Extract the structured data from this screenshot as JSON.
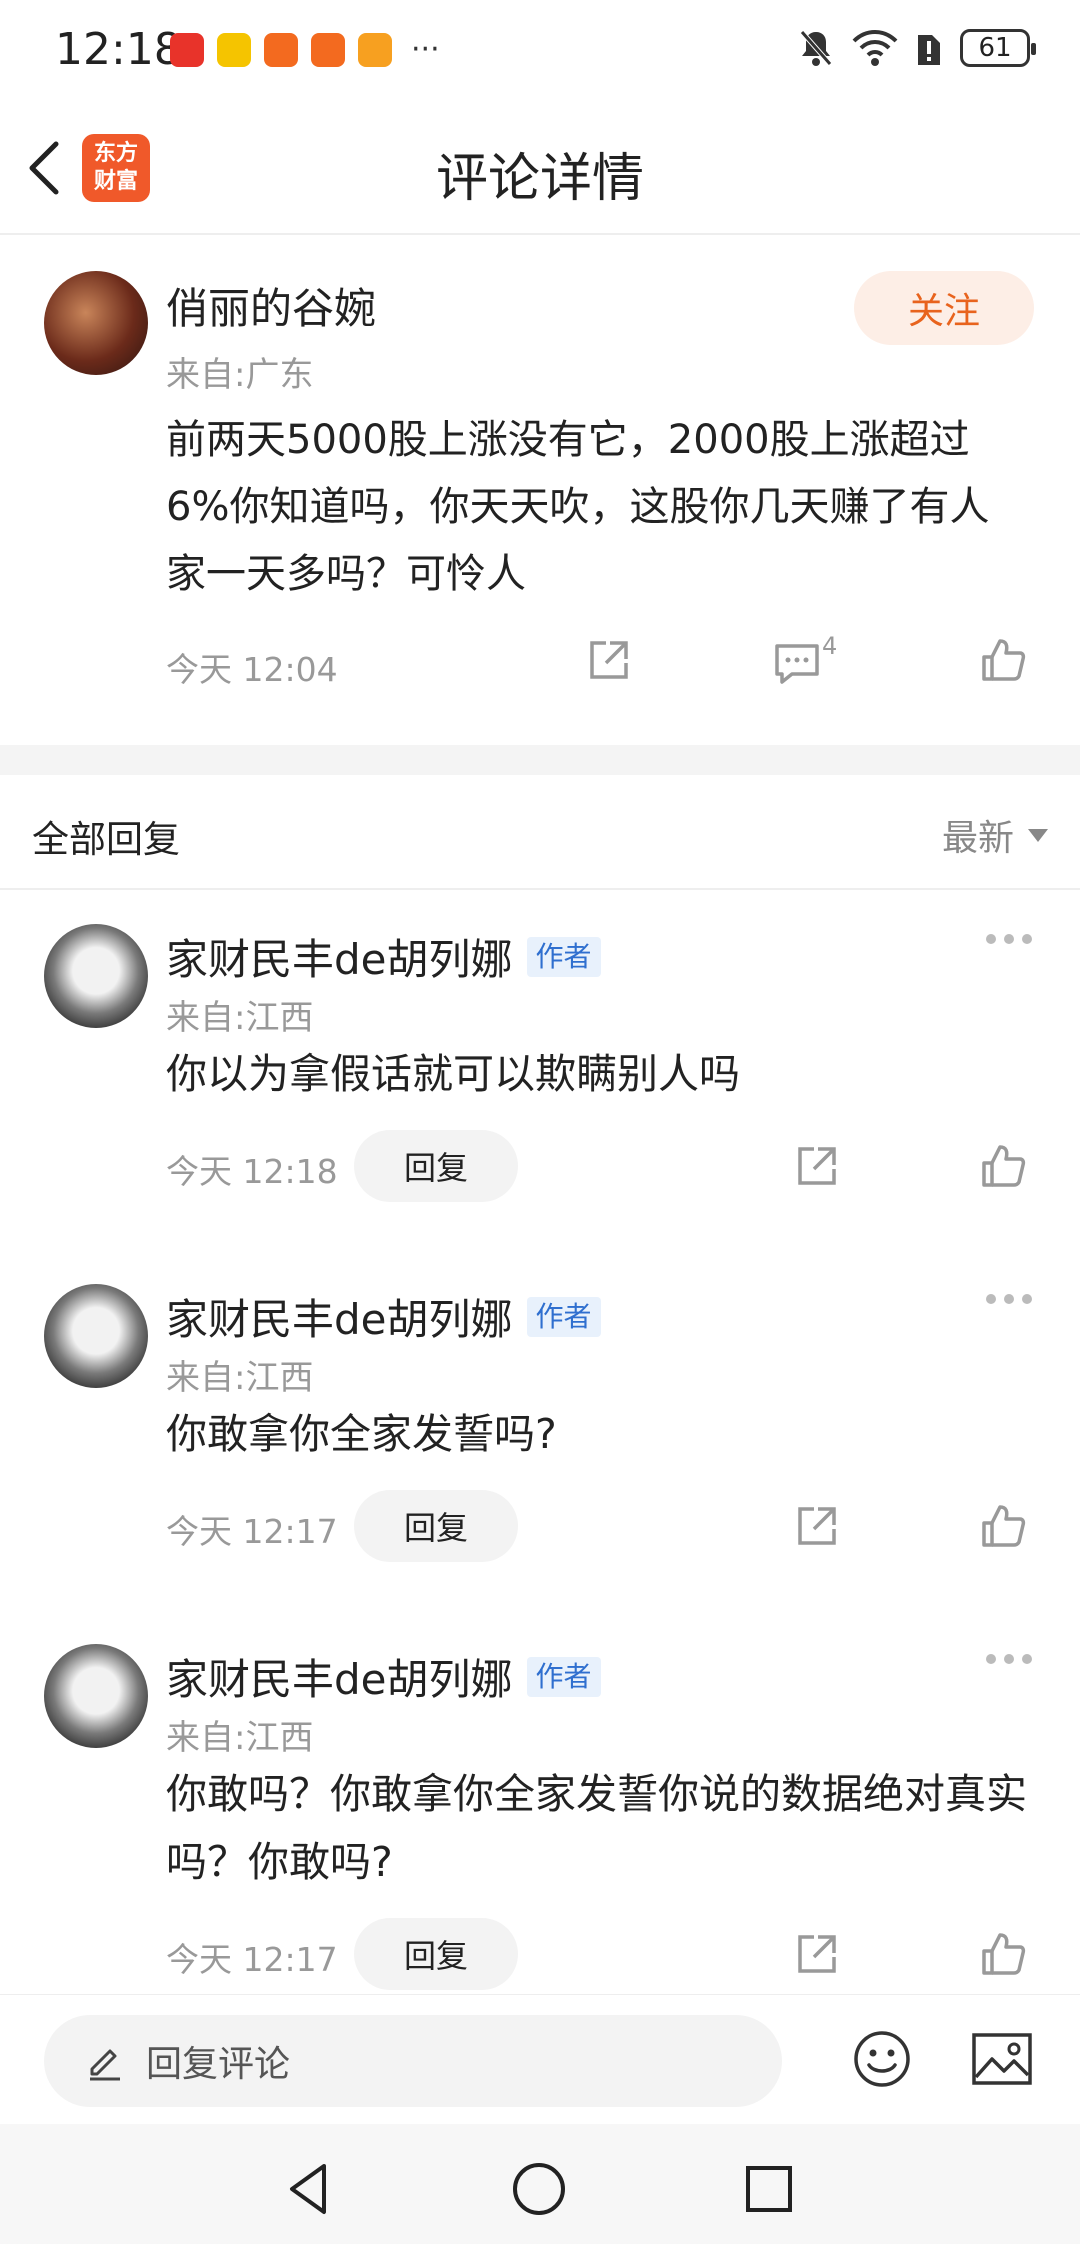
{
  "status_bar": {
    "time": "12:18",
    "more": "···",
    "battery": "61",
    "app_icons": [
      {
        "name": "app-icon-1",
        "color": "#e8332a"
      },
      {
        "name": "weibo-icon",
        "color": "#f5c400"
      },
      {
        "name": "app-icon-3",
        "color": "#f36a1f"
      },
      {
        "name": "app-icon-4",
        "color": "#f36a1f"
      },
      {
        "name": "app-icon-5",
        "color": "#f7a020"
      }
    ]
  },
  "nav": {
    "logo_line1": "东方",
    "logo_line2": "财富",
    "title": "评论详情"
  },
  "main_comment": {
    "author": "俏丽的谷婉",
    "region": "来自:广东",
    "follow_label": "关注",
    "text": "前两天5000股上涨没有它，2000股上涨超过6%你知道吗，你天天吹，这股你几天赚了有人家一天多吗？可怜人",
    "time": "今天 12:04",
    "comment_count": "4"
  },
  "replies_header": {
    "title": "全部回复",
    "sort": "最新"
  },
  "replies": [
    {
      "author": "家财民丰de胡列娜",
      "tag": "作者",
      "region": "来自:江西",
      "text": "你以为拿假话就可以欺瞒别人吗",
      "time": "今天 12:18",
      "reply_label": "回复"
    },
    {
      "author": "家财民丰de胡列娜",
      "tag": "作者",
      "region": "来自:江西",
      "text": "你敢拿你全家发誓吗?",
      "time": "今天 12:17",
      "reply_label": "回复"
    },
    {
      "author": "家财民丰de胡列娜",
      "tag": "作者",
      "region": "来自:江西",
      "text": "你敢吗？你敢拿你全家发誓你说的数据绝对真实吗？你敢吗?",
      "time": "今天 12:17",
      "reply_label": "回复"
    }
  ],
  "input_bar": {
    "placeholder": "回复评论"
  },
  "colors": {
    "accent": "#e8631d",
    "logo": "#f0592a",
    "author_tag": "#2f6fcf"
  }
}
